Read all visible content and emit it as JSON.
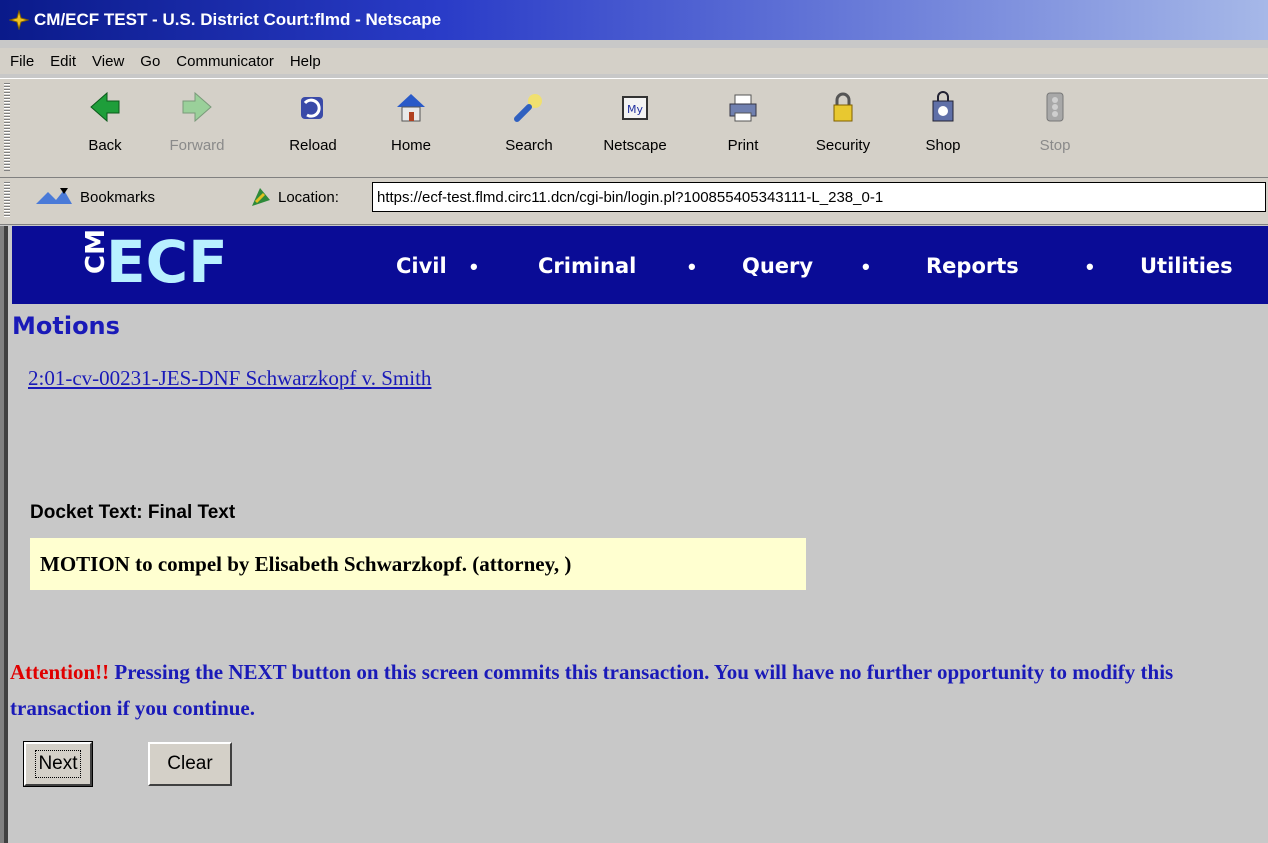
{
  "window": {
    "title": "CM/ECF TEST - U.S. District Court:flmd - Netscape"
  },
  "menubar": {
    "items": [
      "File",
      "Edit",
      "View",
      "Go",
      "Communicator",
      "Help"
    ]
  },
  "toolbar": {
    "buttons": [
      {
        "label": "Back",
        "icon": "back-arrow-icon",
        "enabled": true
      },
      {
        "label": "Forward",
        "icon": "forward-arrow-icon",
        "enabled": false
      },
      {
        "label": "Reload",
        "icon": "reload-icon",
        "enabled": true
      },
      {
        "label": "Home",
        "icon": "home-icon",
        "enabled": true
      },
      {
        "label": "Search",
        "icon": "search-icon",
        "enabled": true
      },
      {
        "label": "Netscape",
        "icon": "my-netscape-icon",
        "enabled": true
      },
      {
        "label": "Print",
        "icon": "printer-icon",
        "enabled": true
      },
      {
        "label": "Security",
        "icon": "padlock-icon",
        "enabled": true
      },
      {
        "label": "Shop",
        "icon": "shopping-bag-icon",
        "enabled": true
      },
      {
        "label": "Stop",
        "icon": "stop-icon",
        "enabled": false
      }
    ]
  },
  "locationbar": {
    "bookmarks_label": "Bookmarks",
    "location_label": "Location:",
    "url": "https://ecf-test.flmd.circ11.dcn/cgi-bin/login.pl?100855405343111-L_238_0-1"
  },
  "ecf": {
    "logo_cm": "CM",
    "logo_ecf": "ECF",
    "menu": [
      "Civil",
      "Criminal",
      "Query",
      "Reports",
      "Utilities"
    ],
    "separator": "•"
  },
  "page": {
    "heading": "Motions",
    "case_link": "2:01-cv-00231-JES-DNF Schwarzkopf v. Smith",
    "docket_label": "Docket Text: Final Text",
    "docket_text": "MOTION to compel by Elisabeth Schwarzkopf. (attorney, )",
    "attention_prefix": "Attention!!",
    "attention_text": "Pressing the NEXT button on this screen commits this transaction. You will have no further opportunity to modify this transaction if you continue.",
    "next_button": "Next",
    "clear_button": "Clear"
  },
  "colors": {
    "ecf_bar": "#0a0c96",
    "link_blue": "#1a1ab8",
    "attention_red": "#e00000",
    "docket_bg": "#ffffd0"
  }
}
